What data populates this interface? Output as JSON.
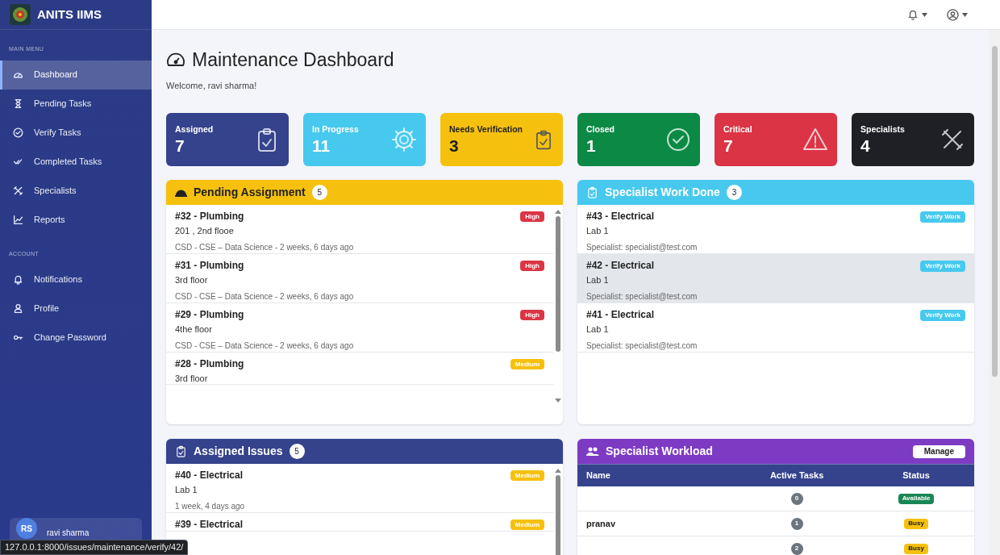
{
  "brand": {
    "title": "ANITS IIMS"
  },
  "sidebar": {
    "sections": [
      {
        "label": "MAIN MENU",
        "items": [
          {
            "label": "Dashboard",
            "selected": true
          },
          {
            "label": "Pending Tasks",
            "selected": false
          },
          {
            "label": "Verify Tasks",
            "selected": false
          },
          {
            "label": "Completed Tasks",
            "selected": false
          },
          {
            "label": "Specialists",
            "selected": false
          },
          {
            "label": "Reports",
            "selected": false
          }
        ]
      },
      {
        "label": "ACCOUNT",
        "items": [
          {
            "label": "Notifications",
            "selected": false
          },
          {
            "label": "Profile",
            "selected": false
          },
          {
            "label": "Change Password",
            "selected": false
          }
        ]
      }
    ],
    "user": {
      "initials": "RS",
      "name": "ravi sharma"
    }
  },
  "page": {
    "title": "Maintenance Dashboard",
    "subtitle": "Welcome, ravi sharma!"
  },
  "stats": [
    {
      "label": "Assigned",
      "value": "7",
      "color": "#35428c"
    },
    {
      "label": "In Progress",
      "value": "11",
      "color": "#47c9ef"
    },
    {
      "label": "Needs Verification",
      "value": "3",
      "color": "#f5c10e"
    },
    {
      "label": "Closed",
      "value": "1",
      "color": "#0c8a45"
    },
    {
      "label": "Critical",
      "value": "7",
      "color": "#db3445"
    },
    {
      "label": "Specialists",
      "value": "4",
      "color": "#1e2026"
    }
  ],
  "pending_assignment": {
    "title": "Pending Assignment",
    "count": "5",
    "items": [
      {
        "title": "#32 - Plumbing",
        "location": "201 , 2nd flooe",
        "meta": "CSD - CSE – Data Science - 2 weeks, 6 days ago",
        "priority": "High",
        "color": "#dc3545"
      },
      {
        "title": "#31 - Plumbing",
        "location": "3rd floor",
        "meta": "CSD - CSE – Data Science - 2 weeks, 6 days ago",
        "priority": "High",
        "color": "#dc3545"
      },
      {
        "title": "#29 - Plumbing",
        "location": "4the floor",
        "meta": "CSD - CSE – Data Science - 2 weeks, 6 days ago",
        "priority": "High",
        "color": "#dc3545"
      },
      {
        "title": "#28 - Plumbing",
        "location": "3rd floor",
        "priority": "Medium",
        "color": "#f5c10e"
      }
    ]
  },
  "specialist_work_done": {
    "title": "Specialist Work Done",
    "count": "3",
    "items": [
      {
        "title": "#43 - Electrical",
        "location": "Lab 1",
        "meta": "Specialist: specialist@test.com",
        "action": "Verify Work",
        "hovered": false
      },
      {
        "title": "#42 - Electrical",
        "location": "Lab 1",
        "meta": "Specialist: specialist@test.com",
        "action": "Verify Work",
        "hovered": true
      },
      {
        "title": "#41 - Electrical",
        "location": "Lab 1",
        "meta": "Specialist: specialist@test.com",
        "action": "Verify Work",
        "hovered": false
      }
    ]
  },
  "assigned_issues": {
    "title": "Assigned Issues",
    "count": "5",
    "items": [
      {
        "title": "#40 - Electrical",
        "location": "Lab 1",
        "meta": "1 week, 4 days ago",
        "priority": "Medium",
        "color": "#f5c10e"
      },
      {
        "title": "#39 - Electrical",
        "priority": "Medium",
        "color": "#f5c10e"
      }
    ]
  },
  "specialist_workload": {
    "title": "Specialist Workload",
    "action": "Manage",
    "columns": [
      "Name",
      "Active Tasks",
      "Status"
    ],
    "rows": [
      {
        "active_tasks": "0",
        "status": "Available",
        "color": "#198754"
      },
      {
        "name": "pranav",
        "active_tasks": "1",
        "status": "Busy",
        "color": "#f5c10e"
      },
      {
        "active_tasks": "2",
        "status": "Busy",
        "color": "#f5c10e"
      }
    ]
  },
  "status_bar": {
    "url": "127.0.0.1:8000/issues/maintenance/verify/42/"
  }
}
